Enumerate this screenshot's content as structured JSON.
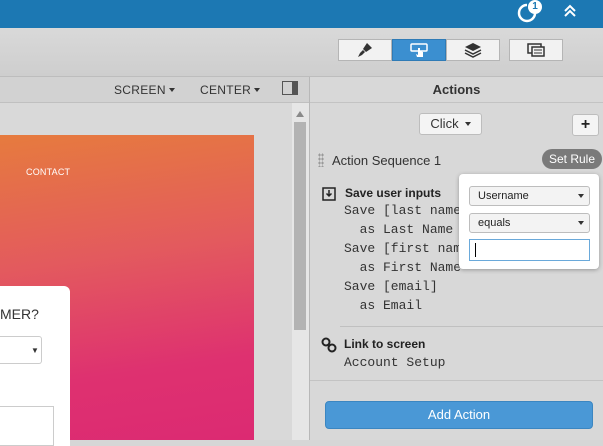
{
  "topbar": {
    "notification_count": "1"
  },
  "canvas_header": {
    "screen_label": "SCREEN",
    "align_label": "CENTER"
  },
  "artboard": {
    "contact_label": "CONTACT",
    "card_heading": "MER?"
  },
  "actions": {
    "title": "Actions",
    "trigger_label": "Click",
    "add_trigger_label": "+",
    "sequence_label": "Action Sequence 1",
    "set_rule_label": "Set Rule",
    "save_inputs_title": "Save user inputs",
    "save_lines": [
      "Save [last name",
      "  as Last Name",
      "Save [first nam",
      "  as First Name",
      "Save [email]",
      "  as Email"
    ],
    "link_title": "Link to screen",
    "link_target": "Account Setup",
    "add_action_label": "Add Action"
  },
  "rule_popover": {
    "field_value": "Username",
    "operator_value": "equals",
    "rule_value": ""
  },
  "colors": {
    "topbar": "#1c78b3",
    "accent": "#4a98d6",
    "artboard_top": "#e67b3e",
    "artboard_bottom": "#dc2a72"
  }
}
